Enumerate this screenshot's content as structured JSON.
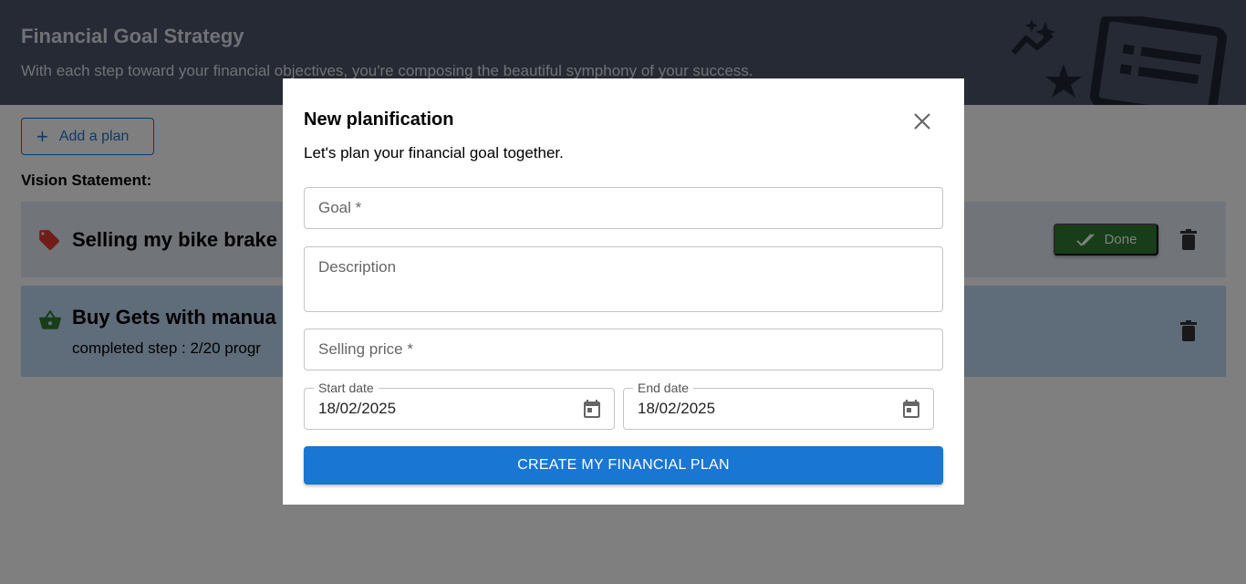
{
  "header": {
    "title": "Financial Goal Strategy",
    "subtitle": "With each step toward your financial objectives, you're composing the beautiful symphony of your success."
  },
  "toolbar": {
    "add_plan_label": "Add a plan"
  },
  "vision": {
    "label": "Vision Statement:"
  },
  "plans": [
    {
      "title": "Selling my bike brake",
      "icon": "tag-icon",
      "icon_color": "#e53935",
      "done_label": "Done"
    },
    {
      "title": "Buy Gets with manua",
      "icon": "basket-icon",
      "icon_color": "#2e7d32",
      "progress_text": "completed step : 2/20  progr"
    }
  ],
  "modal": {
    "title": "New planification",
    "subtitle": "Let's plan your financial goal together.",
    "goal_placeholder": "Goal *",
    "description_placeholder": "Description",
    "price_placeholder": "Selling price *",
    "start_date_label": "Start date",
    "start_date_value": "18/02/2025",
    "end_date_label": "End date",
    "end_date_value": "18/02/2025",
    "submit_label": "CREATE MY FINANCIAL PLAN"
  },
  "colors": {
    "primary": "#1976d2",
    "success": "#2e7d32",
    "header_bg": "#4a5568"
  }
}
